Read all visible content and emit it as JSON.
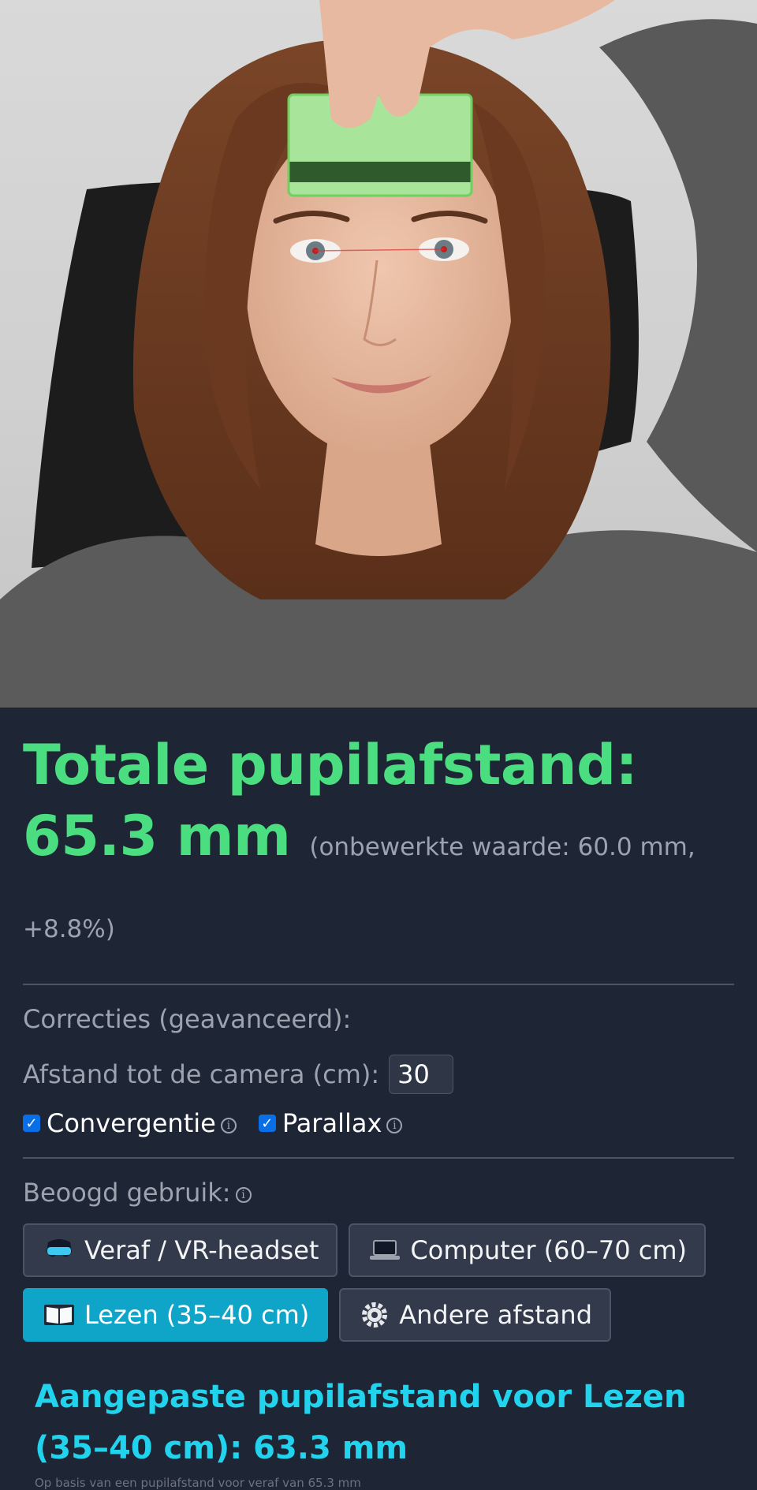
{
  "photo": {
    "alt": "pupil-measurement-photo"
  },
  "measurement": {
    "total_label": "Totale pupilafstand: 65.3 mm",
    "raw_label": "(onbewerkte waarde: 60.0 mm, +8.8%)"
  },
  "corrections": {
    "heading": "Correcties (geavanceerd):",
    "distance_label": "Afstand tot de camera (cm):",
    "distance_value": "30",
    "convergence_label": "Convergentie",
    "convergence_checked": true,
    "parallax_label": "Parallax",
    "parallax_checked": true
  },
  "usage": {
    "heading": "Beoogd gebruik:",
    "options": [
      {
        "label": "Veraf / VR-headset",
        "icon": "vr-headset-icon",
        "active": false
      },
      {
        "label": "Computer (60–70 cm)",
        "icon": "laptop-icon",
        "active": false
      },
      {
        "label": "Lezen (35–40 cm)",
        "icon": "book-icon",
        "active": true
      },
      {
        "label": "Andere afstand",
        "icon": "gear-icon",
        "active": false
      }
    ]
  },
  "result": {
    "title": "Aangepaste pupilafstand voor Lezen (35–40 cm): 63.3 mm",
    "note": "Op basis van een pupilafstand voor veraf van 65.3 mm"
  },
  "colors": {
    "background": "#1e2535",
    "total_green": "#4ade80",
    "result_cyan": "#22d3ee",
    "active_button": "#0ea5c8"
  }
}
